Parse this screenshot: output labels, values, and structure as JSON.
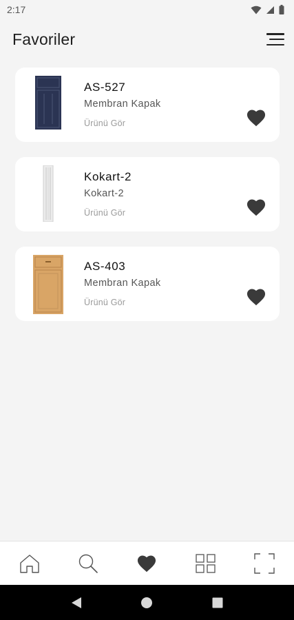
{
  "status_bar": {
    "time": "2:17"
  },
  "header": {
    "title": "Favoriler"
  },
  "favorites": [
    {
      "name": "AS-527",
      "category": "Membran Kapak",
      "link": "Ürünü Gör",
      "thumb_color": "#2b3453"
    },
    {
      "name": "Kokart-2",
      "category": "Kokart-2",
      "link": "Ürünü Gör",
      "thumb_color": "#e8e8e8"
    },
    {
      "name": "AS-403",
      "category": "Membran Kapak",
      "link": "Ürünü Gör",
      "thumb_color": "#d9a566"
    }
  ],
  "bottom_nav": {
    "items": [
      "home-icon",
      "search-icon",
      "heart-icon",
      "grid-icon",
      "scan-frame-icon"
    ],
    "active": "heart-icon"
  },
  "system_nav": [
    "back-icon",
    "home-circle-icon",
    "recents-square-icon"
  ],
  "colors": {
    "background": "#f4f4f4",
    "card": "#ffffff",
    "icon": "#333333"
  }
}
